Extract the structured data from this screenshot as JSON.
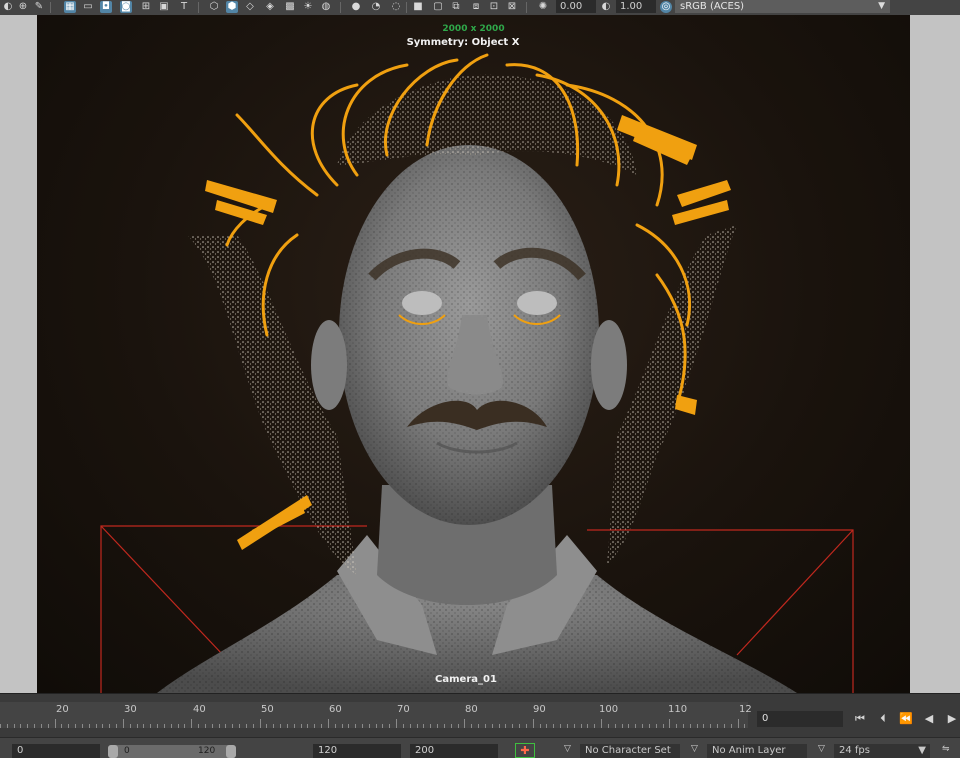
{
  "toolbar": {
    "icons": [
      "camera-lock-icon",
      "pan-zoom-icon",
      "pencil-icon",
      "grid-icon",
      "film-gate-icon",
      "resolution-gate-icon",
      "gate-mask-icon",
      "field-chart-icon",
      "safe-action-icon",
      "safe-title-icon",
      "wireframe-icon",
      "smooth-shade-icon",
      "default-material-icon",
      "textured-icon",
      "use-lights-icon",
      "shadows-icon",
      "ambient-occlusion-icon",
      "motion-blur-icon",
      "anti-alias-icon",
      "depth-of-field-icon",
      "isolate-select-icon",
      "xray-icon",
      "xray-joints-icon",
      "backface-icon",
      "exposure-icon",
      "gamma-icon",
      "color-management-icon"
    ],
    "exposure_value": "0.00",
    "gamma_value": "1.00",
    "color_space": "sRGB (ACES)"
  },
  "viewport": {
    "resolution_gate": "2000 x 2000",
    "symmetry": "Symmetry: Object X",
    "camera_name": "Camera_01"
  },
  "timeline": {
    "ticks": [
      "20",
      "30",
      "40",
      "50",
      "60",
      "70",
      "80",
      "90",
      "100",
      "110",
      "12"
    ],
    "current_frame": "0"
  },
  "rangebar": {
    "start_frame": "0",
    "range_start": "0",
    "range_end": "120",
    "end_frame": "120",
    "anim_end": "200",
    "character_set": "No Character Set",
    "anim_layer": "No Anim Layer",
    "fps": "24 fps"
  },
  "colors": {
    "hair_guide": "#f0a010",
    "camera_frustum": "#c0281e",
    "active_icon": "#5285a6"
  }
}
